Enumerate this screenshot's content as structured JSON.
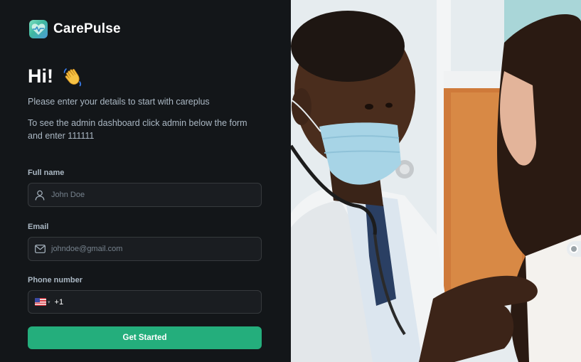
{
  "brand": {
    "name": "CarePulse",
    "logo_icon": "heart-pulse-icon"
  },
  "greeting": {
    "title": "Hi!",
    "emoji_icon": "waving-hand-icon"
  },
  "subtitle": "Please enter your details to start with careplus",
  "admin_hint": "To see the admin dashboard click admin below the form and enter 111111",
  "form": {
    "name": {
      "label": "Full name",
      "placeholder": "John Doe",
      "icon": "user-icon"
    },
    "email": {
      "label": "Email",
      "placeholder": "johndoe@gmail.com",
      "icon": "mail-icon"
    },
    "phone": {
      "label": "Phone number",
      "country_icon": "us-flag-icon",
      "dial_code": "+1"
    },
    "submit_label": "Get Started"
  },
  "colors": {
    "background": "#131619",
    "input_bg": "#1a1d21",
    "input_border": "#363a3d",
    "accent": "#24ae7c",
    "muted_text": "#abb8c4"
  }
}
